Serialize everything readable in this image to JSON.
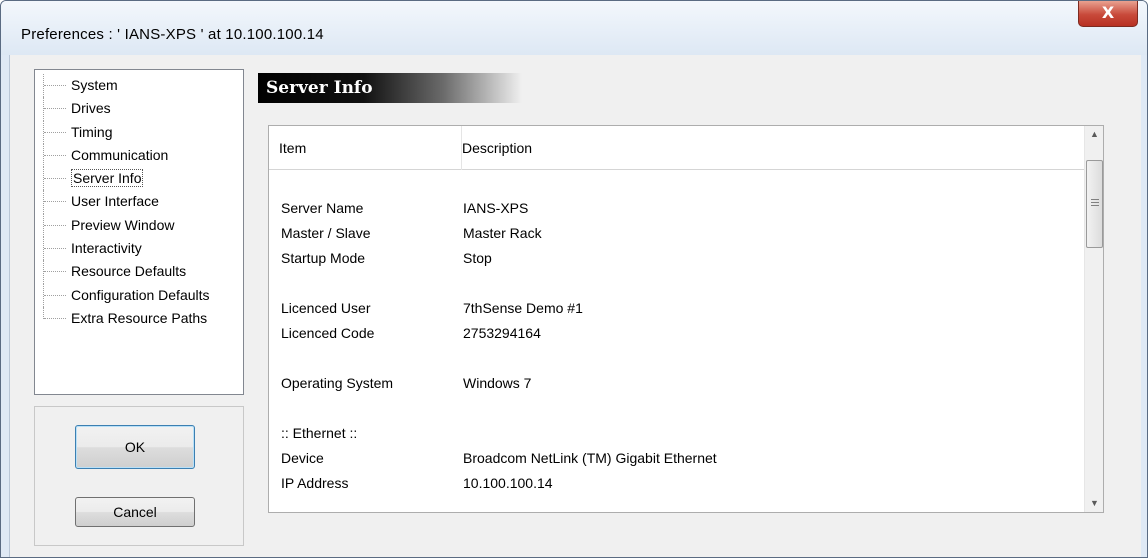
{
  "window": {
    "title": "Preferences  :  ' IANS-XPS '  at  10.100.100.14",
    "close_label": "X"
  },
  "nav": {
    "items": [
      {
        "label": "System"
      },
      {
        "label": "Drives"
      },
      {
        "label": "Timing"
      },
      {
        "label": "Communication"
      },
      {
        "label": "Server Info",
        "selected": true
      },
      {
        "label": "User Interface"
      },
      {
        "label": "Preview Window"
      },
      {
        "label": "Interactivity"
      },
      {
        "label": "Resource Defaults"
      },
      {
        "label": "Configuration Defaults"
      },
      {
        "label": "Extra Resource Paths"
      }
    ]
  },
  "buttons": {
    "ok_label": "OK",
    "cancel_label": "Cancel"
  },
  "section": {
    "title": "Server Info"
  },
  "table": {
    "columns": [
      "Item",
      "Description"
    ],
    "rows": [
      {
        "item": "Server Name",
        "desc": "IANS-XPS"
      },
      {
        "item": "Master / Slave",
        "desc": "Master Rack"
      },
      {
        "item": "Startup Mode",
        "desc": "Stop"
      },
      {
        "item": "",
        "desc": ""
      },
      {
        "item": "Licenced User",
        "desc": "7thSense Demo #1"
      },
      {
        "item": "Licenced Code",
        "desc": "2753294164"
      },
      {
        "item": "",
        "desc": ""
      },
      {
        "item": "Operating System",
        "desc": "Windows 7"
      },
      {
        "item": "",
        "desc": ""
      },
      {
        "item": ":: Ethernet ::",
        "desc": ""
      },
      {
        "item": "Device",
        "desc": "Broadcom NetLink (TM) Gigabit Ethernet"
      },
      {
        "item": "IP Address",
        "desc": "10.100.100.14"
      }
    ]
  },
  "colors": {
    "header_gradient_start": "#000000",
    "close_button": "#c8493a",
    "window_frame": "#dfe9f5"
  }
}
